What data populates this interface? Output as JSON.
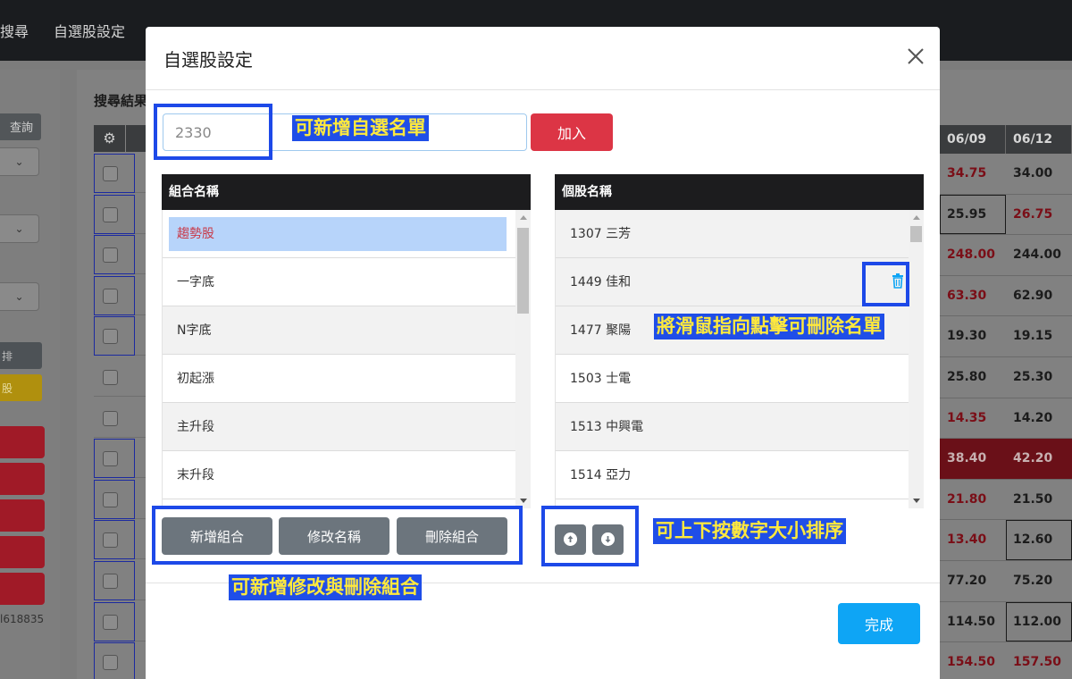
{
  "nav": {
    "items": [
      "搜尋",
      "自選股設定"
    ]
  },
  "background": {
    "search_result_title": "搜尋結果",
    "query_button": "查詢",
    "select_chevron": "⌄",
    "side_text_1": "排",
    "side_text_2": "股",
    "id_text": "l618835",
    "price_table": {
      "headers": [
        "06/09",
        "06/12"
      ],
      "rows": [
        [
          "34.75",
          "34.00"
        ],
        [
          "25.95",
          "26.75"
        ],
        [
          "248.00",
          "244.00"
        ],
        [
          "63.30",
          "62.90"
        ],
        [
          "19.30",
          "19.15"
        ],
        [
          "25.80",
          "25.30"
        ],
        [
          "14.35",
          "14.20"
        ],
        [
          "38.40",
          "42.20"
        ],
        [
          "21.80",
          "21.50"
        ],
        [
          "13.40",
          "12.60"
        ],
        [
          "77.20",
          "75.20"
        ],
        [
          "114.50",
          "112.00"
        ],
        [
          "154.50",
          "157.50"
        ]
      ]
    }
  },
  "modal": {
    "title": "自選股設定",
    "input": {
      "value": "2330",
      "placeholder": "2330"
    },
    "add_button": "加入",
    "group_list": {
      "header": "組合名稱",
      "items": [
        "趨勢股",
        "一字底",
        "N字底",
        "初起漲",
        "主升段",
        "末升段"
      ],
      "selected_index": 0
    },
    "stock_list": {
      "header": "個股名稱",
      "items": [
        "1307 三芳",
        "1449 佳和",
        "1477 聚陽",
        "1503 士電",
        "1513 中興電",
        "1514 亞力"
      ],
      "hover_index": 1
    },
    "group_buttons": {
      "add": "新增組合",
      "rename": "修改名稱",
      "delete": "刪除組合"
    },
    "done_button": "完成"
  },
  "annotations": {
    "add_watchlist": "可新增自選名單",
    "delete_hint": "將滑鼠指向點擊可刪除名單",
    "group_hint": "可新增修改與刪除組合",
    "sort_hint": "可上下按數字大小排序"
  },
  "colors": {
    "add_button": "#dc3545",
    "done_button": "#0ea5f5",
    "group_buttons": "#6c757d",
    "annotation_box": "#1d49e8",
    "annotation_text": "#ffe93d",
    "selected_group_bg": "#b7d4fa",
    "selected_group_text": "#c83a48"
  },
  "icons": {
    "close": "close-icon",
    "trash": "trash-icon",
    "up": "arrow-up-icon",
    "down": "arrow-down-icon",
    "gear": "gear-icon",
    "chevron": "chevron-down-icon"
  }
}
